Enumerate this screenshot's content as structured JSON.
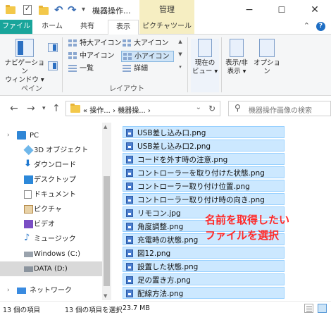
{
  "titlebar": {
    "title": "機器操作...",
    "context_tab": "管理",
    "minimize": "−",
    "maximize": "☐",
    "close": "✕",
    "qa_dropdown": "▾"
  },
  "tabs": {
    "file": "ファイル",
    "home": "ホーム",
    "share": "共有",
    "view": "表示",
    "picture_tools": "ピクチャツール",
    "collapse": "⌃",
    "help": "?"
  },
  "ribbon": {
    "pane_group": {
      "nav_pane_line1": "ナビゲーション",
      "nav_pane_line2": "ウィンドウ ▾",
      "label": "ペイン"
    },
    "layout_group": {
      "items": [
        "特大アイコン",
        "大アイコン",
        "中アイコン",
        "小アイコン",
        "一覧",
        "詳細"
      ],
      "selected": "小アイコン",
      "label": "レイアウト"
    },
    "current_view": {
      "line1": "現在の",
      "line2": "ビュー ▾"
    },
    "show_hide": {
      "line1": "表示/非",
      "line2": "表示 ▾"
    },
    "options": "オプション"
  },
  "address": {
    "back": "←",
    "forward": "→",
    "recent": "▾",
    "up": "↑",
    "path": "« 操作...  ›  機器操...  ›",
    "dropdown": "⌄",
    "refresh": "↻",
    "search_placeholder": "機器操作画像の検索"
  },
  "nav": {
    "items": [
      {
        "label": "PC",
        "icon": "pc-icon"
      },
      {
        "label": "3D オブジェクト",
        "icon": "3d-objects-icon"
      },
      {
        "label": "ダウンロード",
        "icon": "download-icon"
      },
      {
        "label": "デスクトップ",
        "icon": "desktop-icon"
      },
      {
        "label": "ドキュメント",
        "icon": "documents-icon"
      },
      {
        "label": "ピクチャ",
        "icon": "pictures-icon"
      },
      {
        "label": "ビデオ",
        "icon": "videos-icon"
      },
      {
        "label": "ミュージック",
        "icon": "music-icon"
      },
      {
        "label": "Windows (C:)",
        "icon": "drive-icon"
      },
      {
        "label": "DATA (D:)",
        "icon": "drive-icon"
      },
      {
        "label": "ネットワーク",
        "icon": "network-icon"
      }
    ],
    "selected": "DATA (D:)"
  },
  "files": [
    "USB差し込み口.png",
    "USB差し込み口2.png",
    "コードを外す時の注意.png",
    "コントローラーを取り付けた状態.png",
    "コントローラー取り付け位置.png",
    "コントローラー取り付け時の向き.png",
    "リモコン.jpg",
    "角度調整.png",
    "充電時の状態.png",
    "図12.png",
    "設置した状態.png",
    "足の置き方.png",
    "配線方法.png"
  ],
  "annotation": {
    "line1": "名前を取得したい",
    "line2": "ファイルを選択"
  },
  "status": {
    "count": "13 個の項目",
    "selected": "13 個の項目を選択",
    "size": "23.7 MB"
  }
}
